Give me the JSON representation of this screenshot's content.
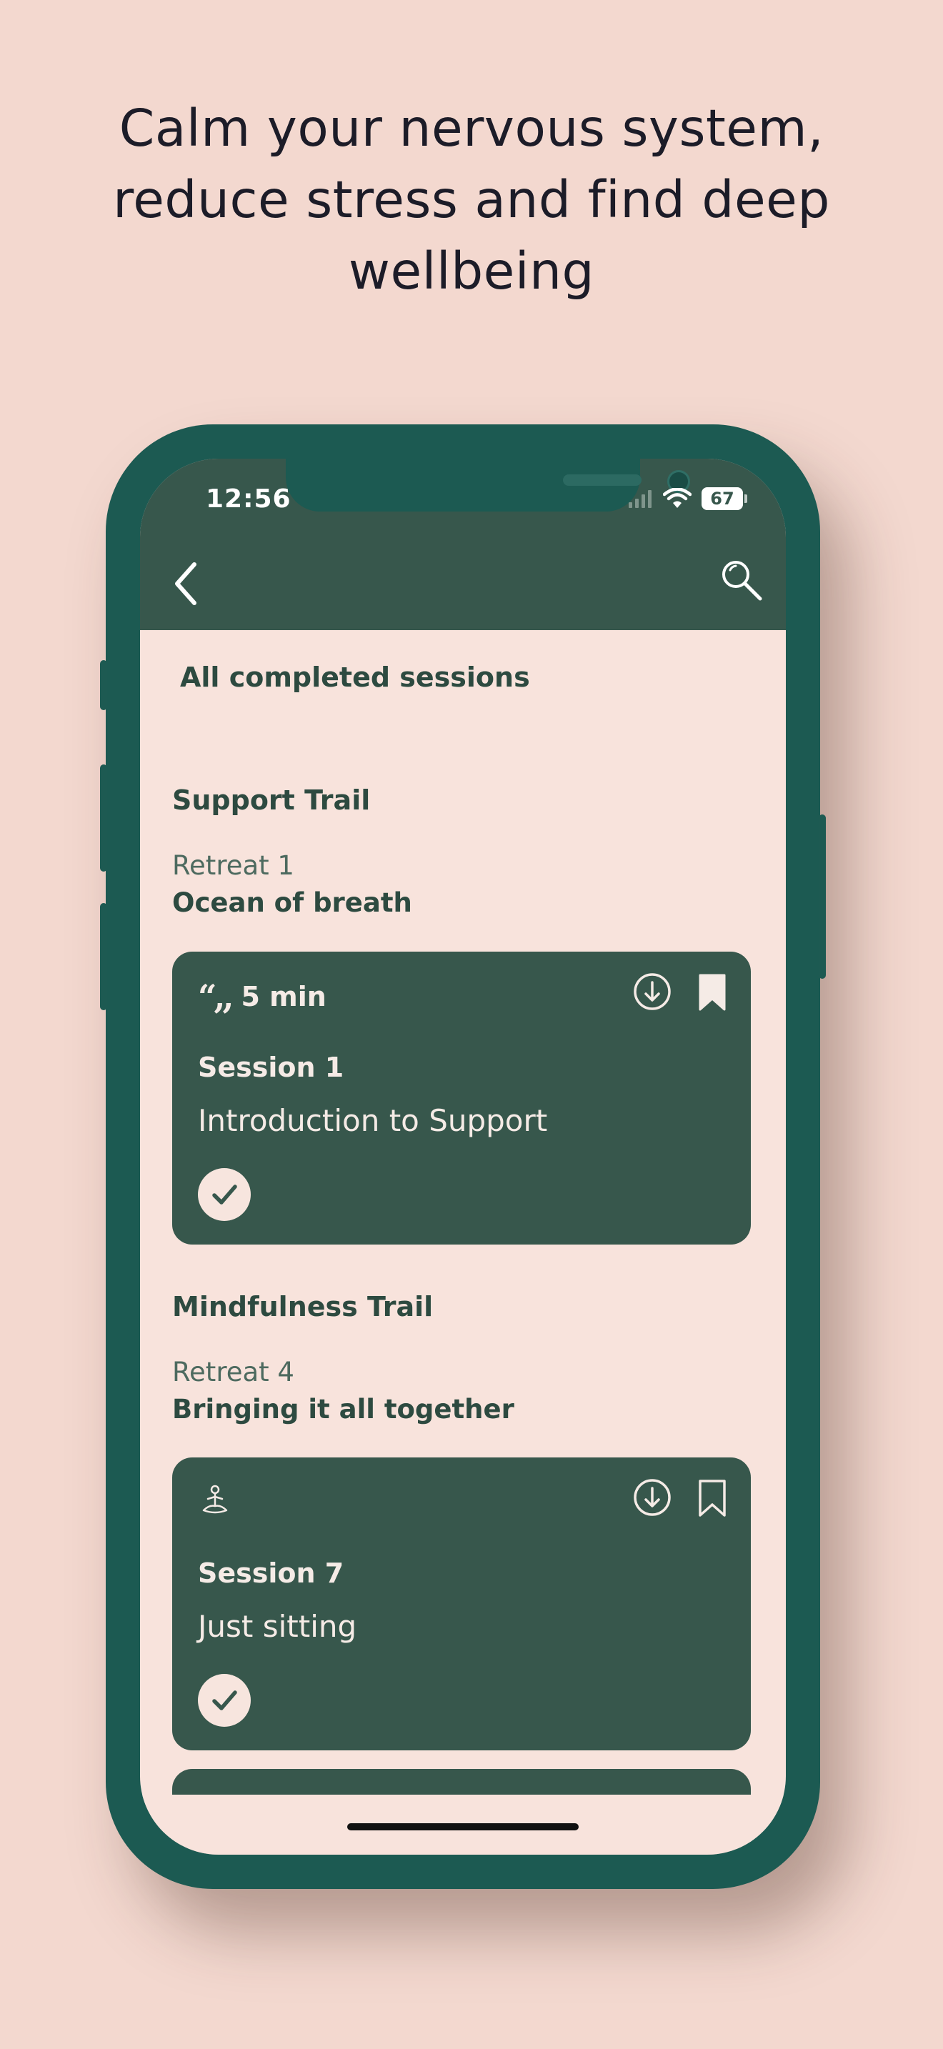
{
  "headline": {
    "line1": "Calm your nervous system,",
    "line2": "reduce stress and find deep",
    "line3": "wellbeing"
  },
  "status_bar": {
    "time": "12:56",
    "battery": "67"
  },
  "nav": {
    "back_icon": "chevron-left-icon",
    "search_icon": "search-icon"
  },
  "page_title": "All completed sessions",
  "groups": [
    {
      "trail": "Support Trail",
      "retreat": "Retreat 1",
      "retreat_title": "Ocean of breath",
      "card": {
        "meta": "5 min",
        "type_icon": "quote-icon",
        "session_label": "Session 1",
        "session_title": "Introduction to Support",
        "completed": true,
        "bookmarked": true
      }
    },
    {
      "trail": "Mindfulness Trail",
      "retreat": "Retreat 4",
      "retreat_title": "Bringing it all together",
      "card": {
        "meta": "",
        "type_icon": "meditation-icon",
        "session_label": "Session 7",
        "session_title": "Just sitting",
        "completed": true,
        "bookmarked": false
      }
    }
  ],
  "colors": {
    "background": "#f3d8cf",
    "phone_frame": "#1c5a52",
    "card": "#37574c",
    "screen": "#f8e3dc",
    "text_dark": "#2d4a40"
  }
}
